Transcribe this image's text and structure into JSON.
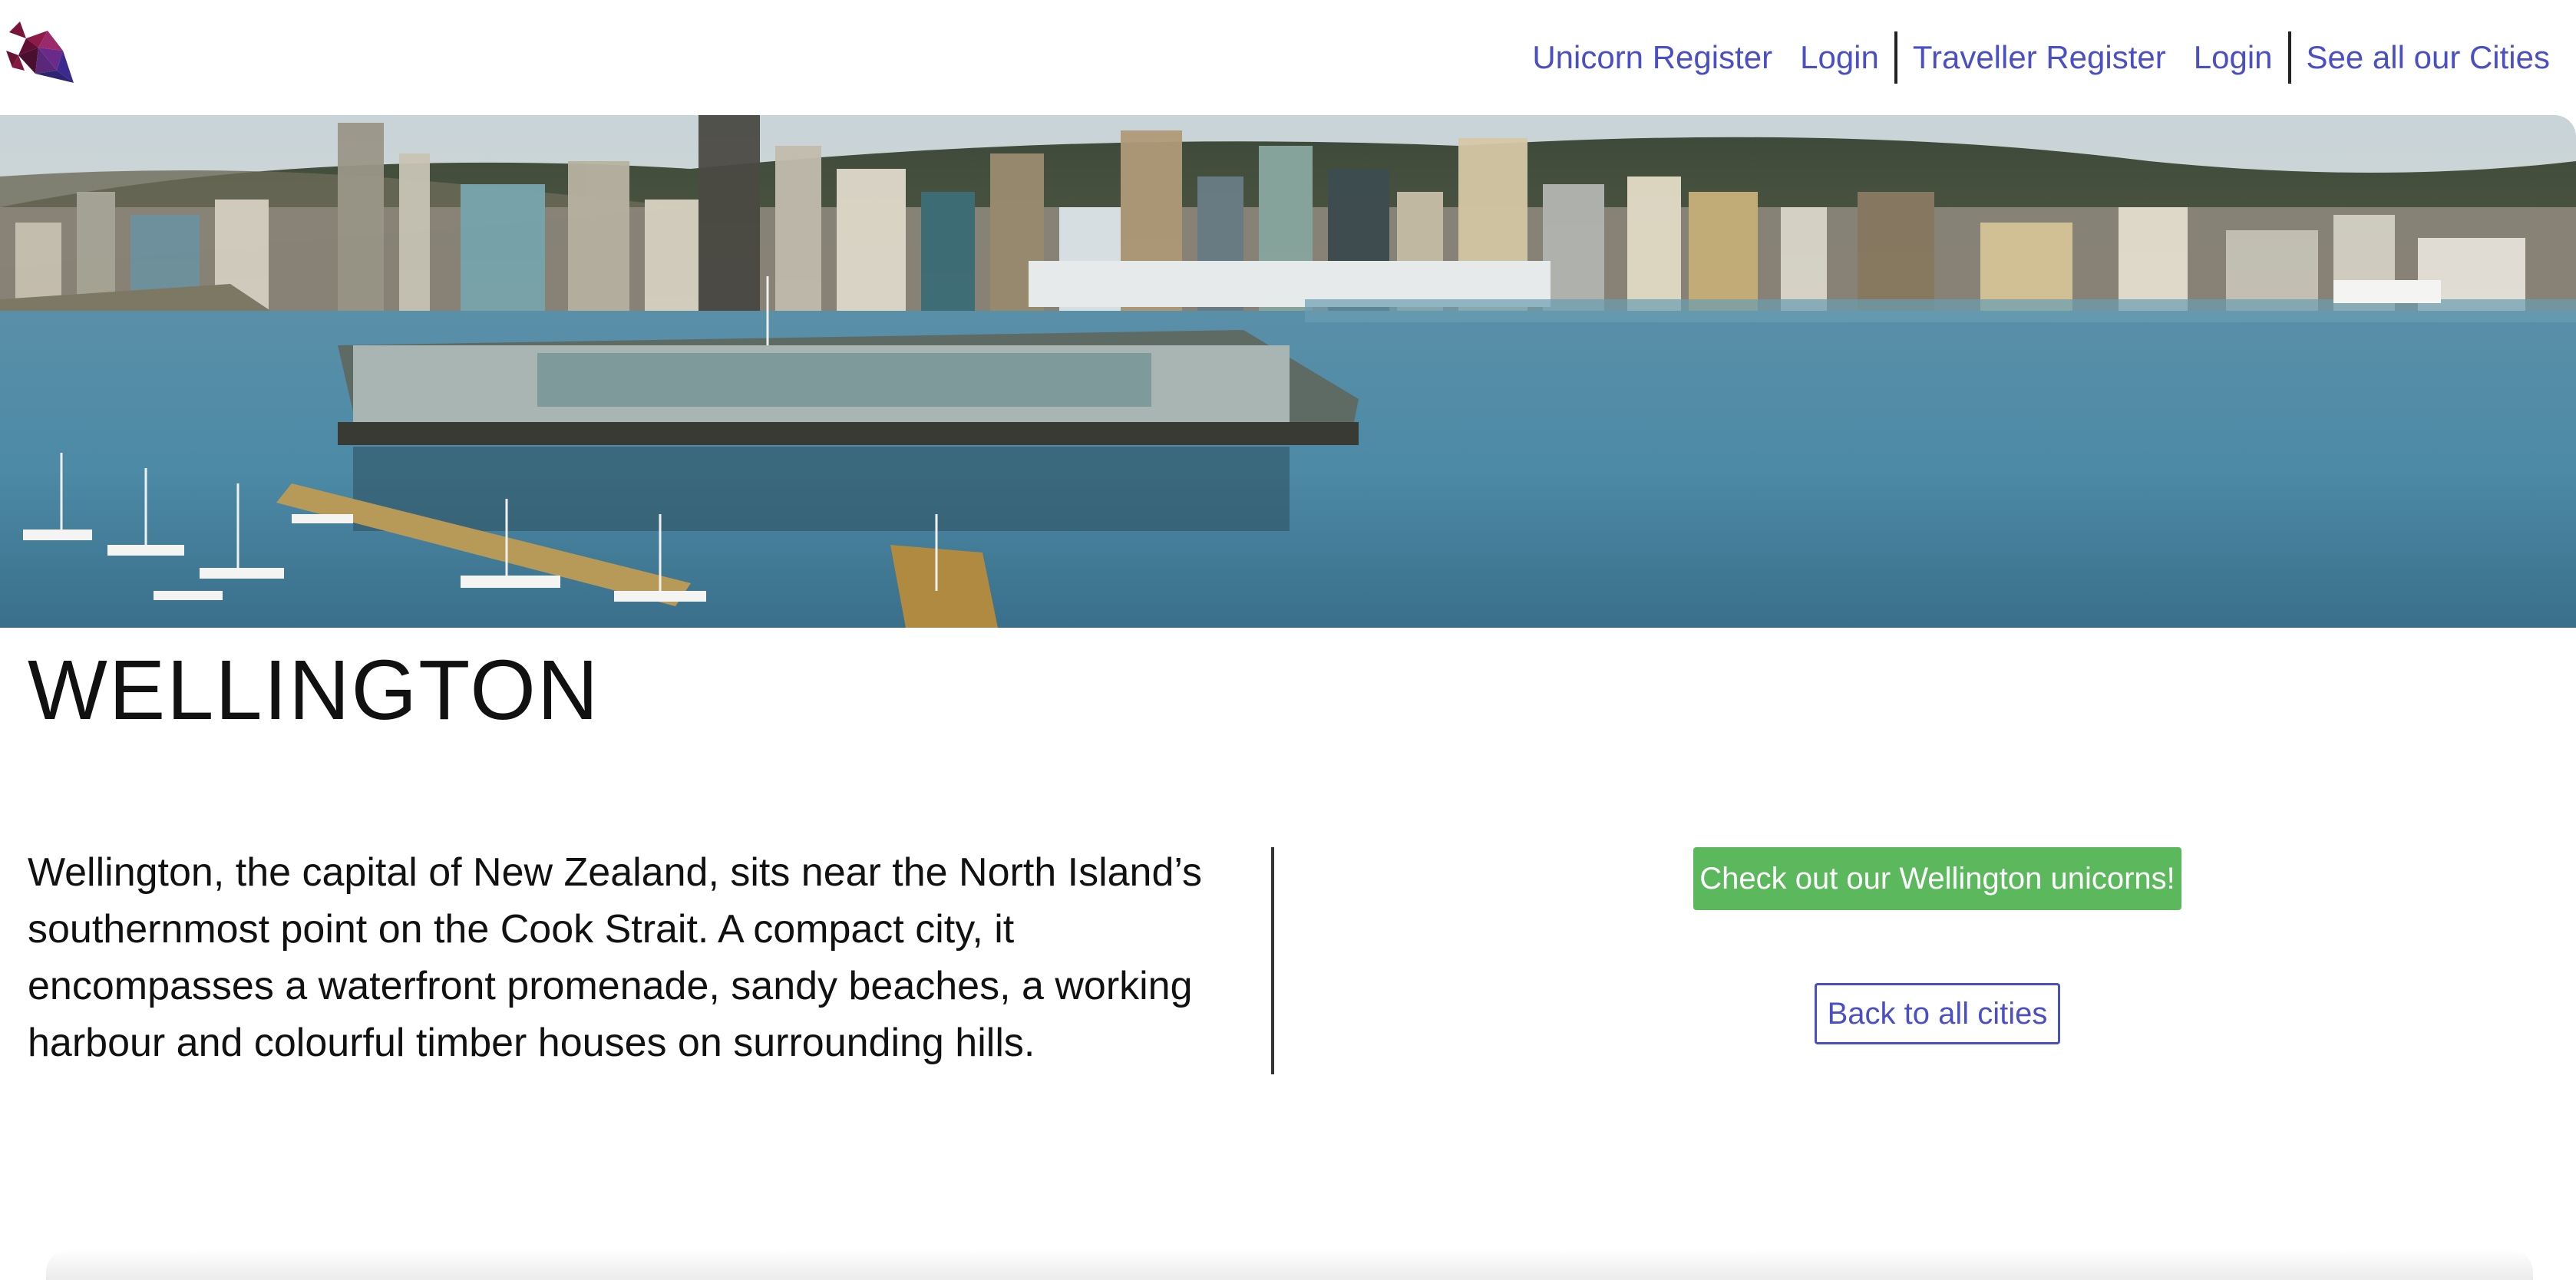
{
  "nav": {
    "logo_icon": "unicorn-head-icon",
    "links": [
      {
        "label": "Unicorn Register"
      },
      {
        "label": "Login"
      },
      {
        "label": "Traveller Register"
      },
      {
        "label": "Login"
      },
      {
        "label": "See all our Cities"
      }
    ],
    "link_color": "#4a4fc4"
  },
  "hero": {
    "scene": "city-harbour-skyline"
  },
  "city": {
    "title": "WELLINGTON",
    "description": "Wellington, the capital of New Zealand, sits near the North Island’s southernmost point on the Cook Strait. A compact city, it encompasses a waterfront promenade, sandy beaches, a working harbour and colourful timber houses on surrounding hills."
  },
  "actions": {
    "primary_label": "Check out our Wellington unicorns!",
    "primary_color": "#5cb85c",
    "secondary_label": "Back to all cities"
  }
}
